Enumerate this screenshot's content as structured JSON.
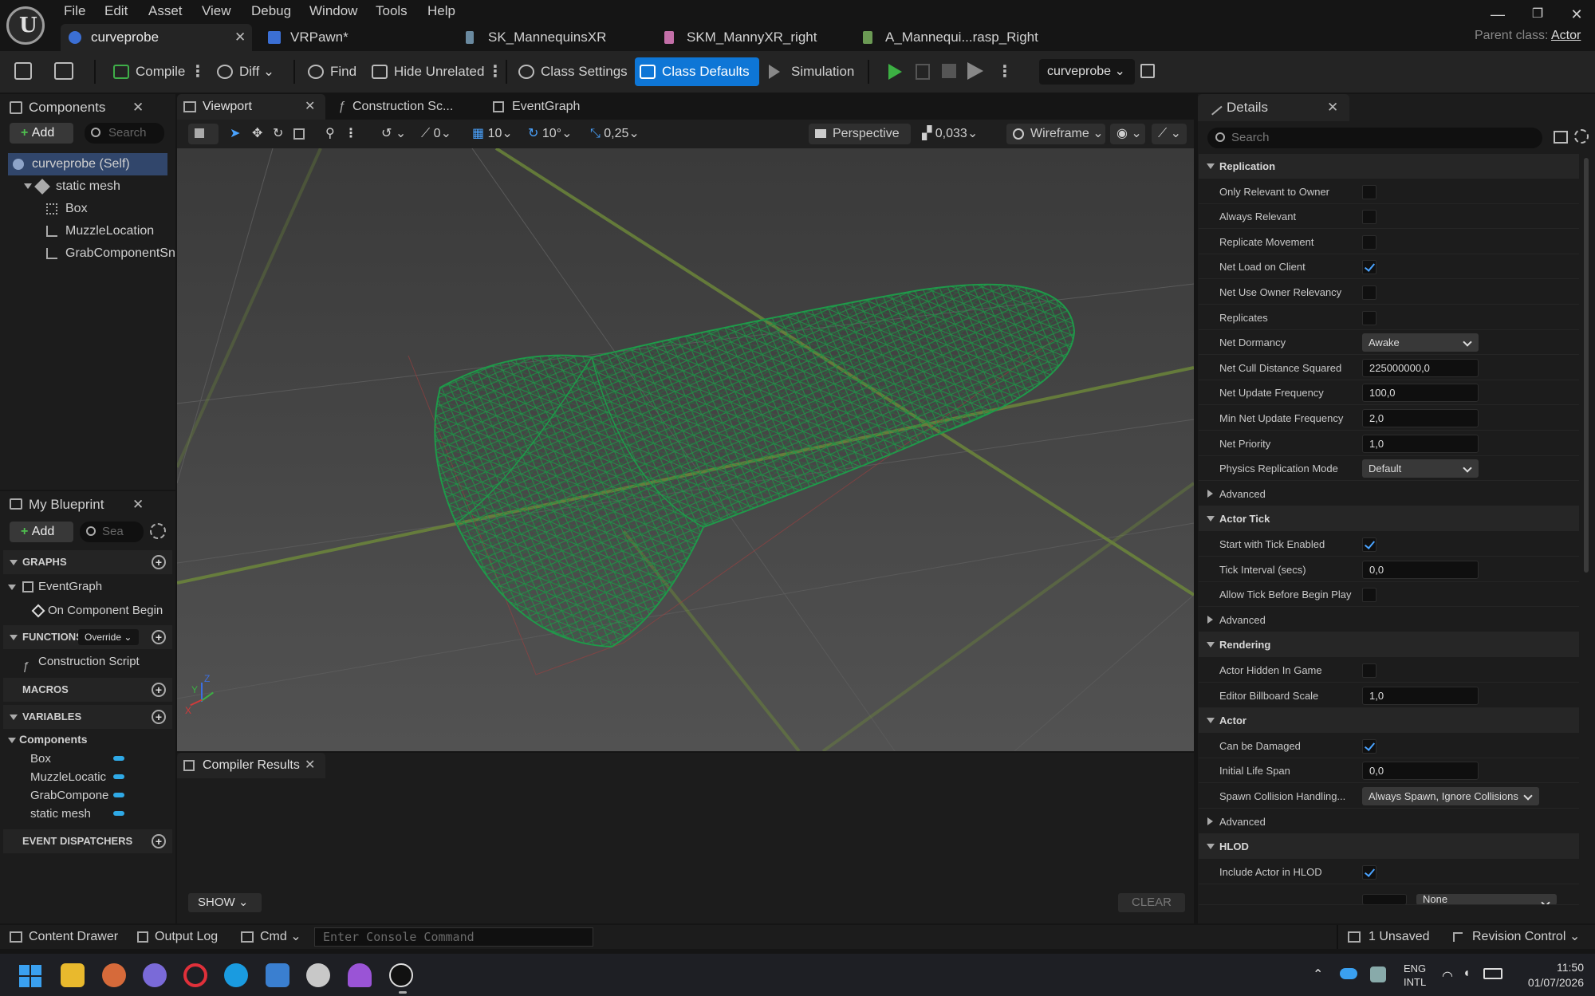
{
  "menu": [
    "File",
    "Edit",
    "Asset",
    "View",
    "Debug",
    "Window",
    "Tools",
    "Help"
  ],
  "tabs": [
    {
      "label": "curveprobe",
      "active": true
    },
    {
      "label": "VRPawn*"
    },
    {
      "label": "SK_MannequinsXR"
    },
    {
      "label": "SKM_MannyXR_right"
    },
    {
      "label": "A_Mannequi...rasp_Right"
    }
  ],
  "parent_class": {
    "label": "Parent class:",
    "value": "Actor"
  },
  "toolbar": {
    "compile": "Compile",
    "diff": "Diff",
    "find": "Find",
    "hide_unrelated": "Hide Unrelated",
    "class_settings": "Class Settings",
    "class_defaults": "Class Defaults",
    "simulation": "Simulation",
    "debug_object": "curveprobe"
  },
  "components_panel": {
    "title": "Components",
    "add": "Add",
    "search_placeholder": "Search",
    "tree": [
      {
        "label": "curveprobe (Self)"
      },
      {
        "label": "static mesh"
      },
      {
        "label": "Box"
      },
      {
        "label": "MuzzleLocation"
      },
      {
        "label": "GrabComponentSn"
      }
    ]
  },
  "viewport_tabs": {
    "viewport": "Viewport",
    "construction": "Construction Sc...",
    "eventgraph": "EventGraph"
  },
  "viewport_toolbar": {
    "snap_angle_count": "0",
    "grid": "10",
    "rotation": "10°",
    "scale": "0,25",
    "perspective": "Perspective",
    "speed": "0,033",
    "view_mode": "Wireframe"
  },
  "axis_labels": {
    "z": "Z",
    "y": "Y",
    "x": "X"
  },
  "my_blueprint": {
    "title": "My Blueprint",
    "add": "Add",
    "search_placeholder": "Sea",
    "graphs_header": "GRAPHS",
    "eventgraph": "EventGraph",
    "event_item": "On Component Begin",
    "functions_header": "FUNCTIONS",
    "override": "Override",
    "construction_script": "Construction Script",
    "macros_header": "MACROS",
    "variables_header": "VARIABLES",
    "components_header": "Components",
    "variables": [
      "Box",
      "MuzzleLocatic",
      "GrabCompone",
      "static mesh"
    ],
    "dispatchers_header": "EVENT DISPATCHERS"
  },
  "compiler": {
    "title": "Compiler Results",
    "show": "SHOW",
    "clear": "CLEAR"
  },
  "details": {
    "title": "Details",
    "search_placeholder": "Search",
    "sections": [
      {
        "name": "Replication",
        "rows": [
          {
            "label": "Only Relevant to Owner",
            "type": "check",
            "checked": false
          },
          {
            "label": "Always Relevant",
            "type": "check",
            "checked": false
          },
          {
            "label": "Replicate Movement",
            "type": "check",
            "checked": false
          },
          {
            "label": "Net Load on Client",
            "type": "check",
            "checked": true
          },
          {
            "label": "Net Use Owner Relevancy",
            "type": "check",
            "checked": false
          },
          {
            "label": "Replicates",
            "type": "check",
            "checked": false
          },
          {
            "label": "Net Dormancy",
            "type": "combo",
            "value": "Awake"
          },
          {
            "label": "Net Cull Distance Squared",
            "type": "input",
            "value": "225000000,0"
          },
          {
            "label": "Net Update Frequency",
            "type": "input",
            "value": "100,0"
          },
          {
            "label": "Min Net Update Frequency",
            "type": "input",
            "value": "2,0"
          },
          {
            "label": "Net Priority",
            "type": "input",
            "value": "1,0"
          },
          {
            "label": "Physics Replication Mode",
            "type": "combo",
            "value": "Default"
          },
          {
            "label": "Advanced",
            "type": "advanced"
          }
        ]
      },
      {
        "name": "Actor Tick",
        "rows": [
          {
            "label": "Start with Tick Enabled",
            "type": "check",
            "checked": true
          },
          {
            "label": "Tick Interval (secs)",
            "type": "input",
            "value": "0,0"
          },
          {
            "label": "Allow Tick Before Begin Play",
            "type": "check",
            "checked": false
          },
          {
            "label": "Advanced",
            "type": "advanced"
          }
        ]
      },
      {
        "name": "Rendering",
        "rows": [
          {
            "label": "Actor Hidden In Game",
            "type": "check",
            "checked": false
          },
          {
            "label": "Editor Billboard Scale",
            "type": "input",
            "value": "1,0"
          }
        ]
      },
      {
        "name": "Actor",
        "rows": [
          {
            "label": "Can be Damaged",
            "type": "check",
            "checked": true
          },
          {
            "label": "Initial Life Span",
            "type": "input",
            "value": "0,0"
          },
          {
            "label": "Spawn Collision Handling...",
            "type": "combo",
            "value": "Always Spawn, Ignore Collisions"
          },
          {
            "label": "Advanced",
            "type": "advanced"
          }
        ]
      },
      {
        "name": "HLOD",
        "rows": [
          {
            "label": "Include Actor in HLOD",
            "type": "check",
            "checked": true
          },
          {
            "label": "",
            "type": "partial",
            "value": "None"
          }
        ]
      }
    ]
  },
  "statusbar": {
    "content_drawer": "Content Drawer",
    "output_log": "Output Log",
    "cmd": "Cmd",
    "console_placeholder": "Enter Console Command",
    "unsaved": "1 Unsaved",
    "revision_control": "Revision Control"
  },
  "taskbar": {
    "lang": "ENG",
    "layout": "INTL",
    "time": "11:50",
    "date": "01/07/2026"
  },
  "colors": {
    "accent": "#0e76d6",
    "wireframe": "#1f9a4a",
    "pill": "#2fa9e6"
  }
}
